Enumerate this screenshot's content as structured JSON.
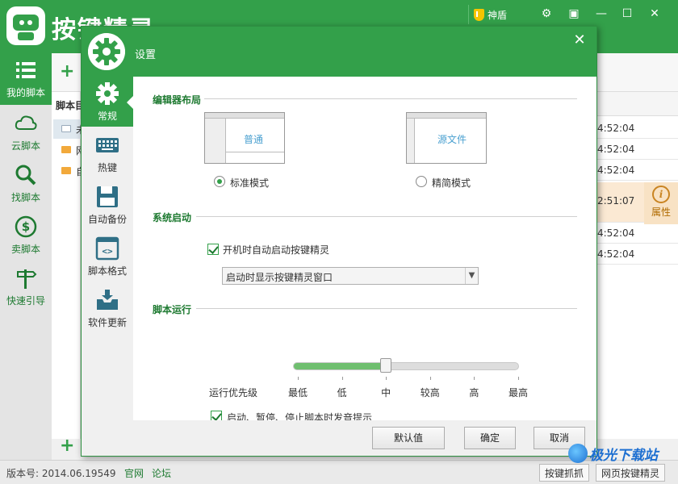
{
  "app": {
    "title": "按键精灵",
    "shield_label": "神盾"
  },
  "left_nav": [
    {
      "label": "我的脚本",
      "icon": "list-icon",
      "active": true
    },
    {
      "label": "云脚本",
      "icon": "cloud-icon"
    },
    {
      "label": "找脚本",
      "icon": "magnifier-icon"
    },
    {
      "label": "卖脚本",
      "icon": "dollar-icon"
    },
    {
      "label": "快速引导",
      "icon": "signpost-icon"
    }
  ],
  "tree": {
    "header": "脚本目录",
    "items": [
      {
        "label": "未",
        "selected": true
      },
      {
        "label": "网"
      },
      {
        "label": "自"
      }
    ]
  },
  "list": {
    "rows": [
      {
        "time": "4:52:04"
      },
      {
        "time": "4:52:04"
      },
      {
        "time": "4:52:04"
      },
      {
        "time": "2:51:07"
      },
      {
        "time": "4:52:04"
      },
      {
        "time": "4:52:04"
      }
    ],
    "property_label": "属性"
  },
  "statusbar": {
    "version": "版本号: 2014.06.19549",
    "link_official": "官网",
    "link_forum": "论坛",
    "btn_capture": "按键抓抓",
    "btn_web": "网页按键精灵"
  },
  "dialog": {
    "title": "设置",
    "sidebar": [
      {
        "label": "常规",
        "icon": "gear-icon",
        "active": true
      },
      {
        "label": "热键",
        "icon": "keyboard-icon"
      },
      {
        "label": "自动备份",
        "icon": "floppy-icon"
      },
      {
        "label": "脚本格式",
        "icon": "code-icon"
      },
      {
        "label": "软件更新",
        "icon": "update-icon"
      }
    ],
    "editor_layout": {
      "title": "编辑器布局",
      "normal_caption": "普通",
      "source_caption": "源文件",
      "option_standard": "标准模式",
      "option_simple": "精简模式",
      "selected": "standard"
    },
    "startup": {
      "title": "系统启动",
      "autostart_label": "开机时自动启动按键精灵",
      "autostart_checked": true,
      "window_option": "启动时显示按键精灵窗口"
    },
    "script_run": {
      "title": "脚本运行",
      "priority_label": "运行优先级",
      "priority_levels": [
        "最低",
        "低",
        "中",
        "较高",
        "高",
        "最高"
      ],
      "priority_value_index": 2,
      "sound_label": "启动、暂停、停止脚本时发音提示",
      "sound_checked": true
    },
    "buttons": {
      "default": "默认值",
      "ok": "确定",
      "cancel": "取消"
    }
  },
  "watermark": "极光下载站"
}
